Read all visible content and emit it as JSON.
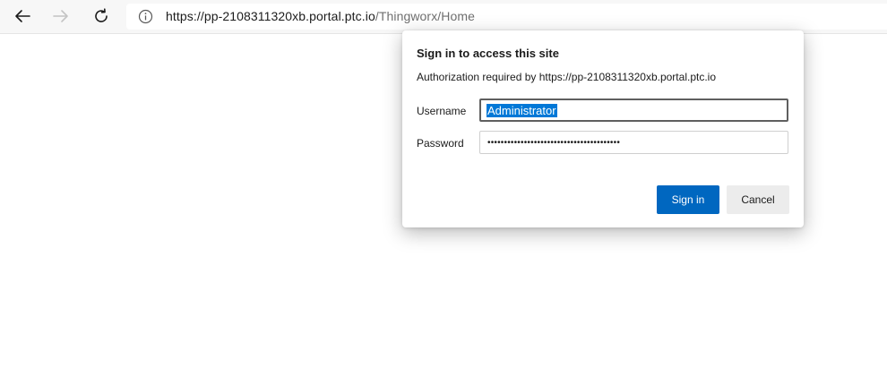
{
  "browser": {
    "url_host": "https://pp-2108311320xb.portal.ptc.io",
    "url_path": "/Thingworx/Home"
  },
  "dialog": {
    "title": "Sign in to access this site",
    "subtitle": "Authorization required by https://pp-2108311320xb.portal.ptc.io",
    "username_label": "Username",
    "username_value": "Administrator",
    "password_label": "Password",
    "password_mask": "••••••••••••••••••••••••••••••••••••••••",
    "sign_in_label": "Sign in",
    "cancel_label": "Cancel"
  },
  "colors": {
    "accent": "#0067c0",
    "selection": "#0078d7"
  }
}
